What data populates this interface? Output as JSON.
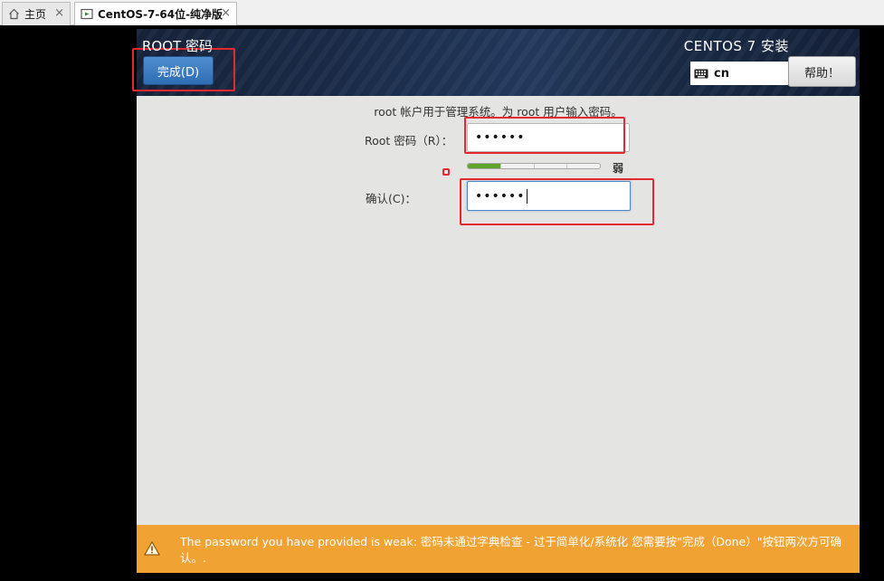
{
  "tabs": [
    {
      "label": "主页",
      "icon": "home-icon"
    },
    {
      "label": "CentOS-7-64位-纯净版",
      "icon": "vm-icon"
    }
  ],
  "installer": {
    "page_title": "ROOT 密码",
    "done_label": "完成(D)",
    "product_title": "CENTOS 7 安装",
    "keyboard_layout": "cn",
    "help_label": "帮助！"
  },
  "form": {
    "instruction": "root 帐户用于管理系统。为 root 用户输入密码。",
    "password_label": "Root 密码（R）：",
    "password_value": "••••••",
    "strength_label": "弱",
    "strength_level": 0.25,
    "confirm_label": "确认(C)：",
    "confirm_value": "••••••"
  },
  "warning": {
    "text": "The password you have provided is weak: 密码未通过字典检查 - 过于简单化/系统化 您需要按\"完成（Done）\"按钮两次方可确认。.",
    "icon": "warning-icon"
  },
  "colors": {
    "accent": "#2f6db3",
    "warning_bg": "#f0a233",
    "strength_fill": "#5fa42b",
    "annotation": "#e4282d"
  }
}
